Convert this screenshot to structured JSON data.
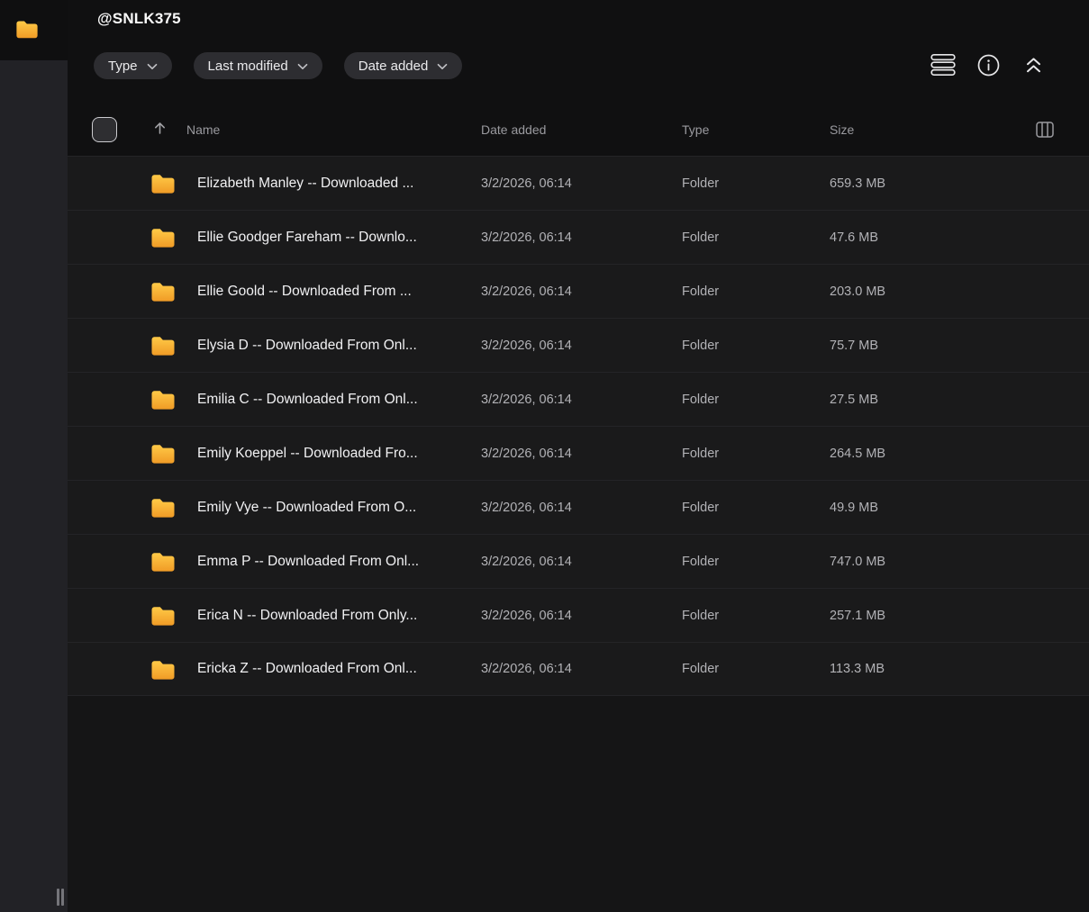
{
  "window": {
    "title": "@SNLK375",
    "app_icon": "folder-icon"
  },
  "colors": {
    "folder_gradient_top": "#FFCA47",
    "folder_gradient_bottom": "#F09B26",
    "background_top": "#101011",
    "background_main": "#151516",
    "sidebar": "#222226",
    "row_background": "#1A1A1B",
    "pill_background": "#2D2D31",
    "text_primary": "#F1F1F3",
    "text_secondary": "#B2B2B6",
    "text_header": "#9A9A9F"
  },
  "toolbar": {
    "filters": [
      {
        "label": "Type",
        "icon": "chevron-down-icon"
      },
      {
        "label": "Last modified",
        "icon": "chevron-down-icon"
      },
      {
        "label": "Date added",
        "icon": "chevron-down-icon"
      }
    ],
    "action_icons": [
      "list-view-icon",
      "info-icon",
      "collapse-up-icon"
    ]
  },
  "table": {
    "header": {
      "name": "Name",
      "date_added": "Date added",
      "type": "Type",
      "size": "Size",
      "sort_icon": "arrow-up-icon",
      "sort_direction": "ascending",
      "columns_icon": "columns-icon"
    },
    "rows": [
      {
        "name": "Elizabeth Manley -- Downloaded ...",
        "date_added": "3/2/2026, 06:14",
        "type": "Folder",
        "size": "659.3 MB"
      },
      {
        "name": "Ellie Goodger Fareham -- Downlo...",
        "date_added": "3/2/2026, 06:14",
        "type": "Folder",
        "size": "47.6 MB"
      },
      {
        "name": "Ellie Goold -- Downloaded From ...",
        "date_added": "3/2/2026, 06:14",
        "type": "Folder",
        "size": "203.0 MB"
      },
      {
        "name": "Elysia D -- Downloaded From Onl...",
        "date_added": "3/2/2026, 06:14",
        "type": "Folder",
        "size": "75.7 MB"
      },
      {
        "name": "Emilia C -- Downloaded From Onl...",
        "date_added": "3/2/2026, 06:14",
        "type": "Folder",
        "size": "27.5 MB"
      },
      {
        "name": "Emily Koeppel -- Downloaded Fro...",
        "date_added": "3/2/2026, 06:14",
        "type": "Folder",
        "size": "264.5 MB"
      },
      {
        "name": "Emily Vye -- Downloaded From O...",
        "date_added": "3/2/2026, 06:14",
        "type": "Folder",
        "size": "49.9 MB"
      },
      {
        "name": "Emma P -- Downloaded From Onl...",
        "date_added": "3/2/2026, 06:14",
        "type": "Folder",
        "size": "747.0 MB"
      },
      {
        "name": "Erica N -- Downloaded From Only...",
        "date_added": "3/2/2026, 06:14",
        "type": "Folder",
        "size": "257.1 MB"
      },
      {
        "name": "Ericka Z -- Downloaded From Onl...",
        "date_added": "3/2/2026, 06:14",
        "type": "Folder",
        "size": "113.3 MB"
      }
    ]
  },
  "sidebar": {
    "resize_handle": "drag-handle"
  }
}
